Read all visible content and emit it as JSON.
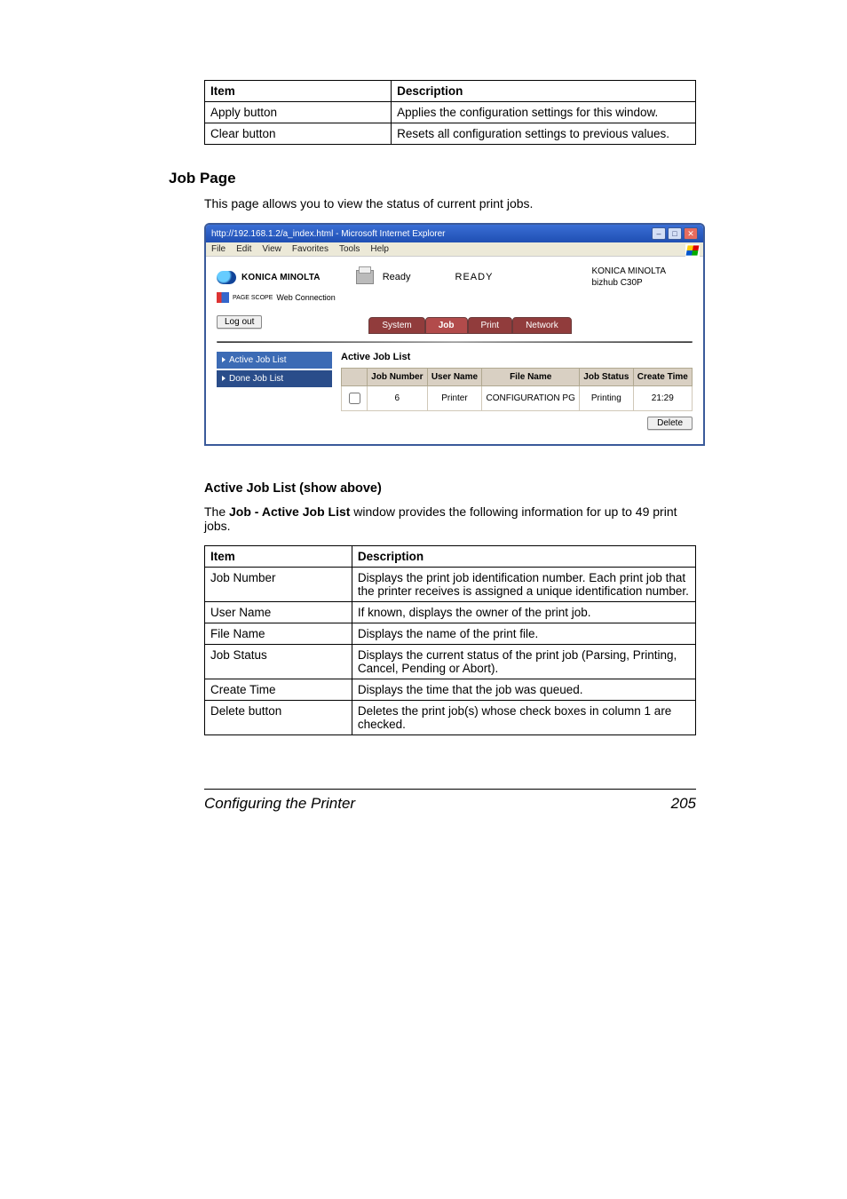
{
  "top_table": {
    "header_item": "Item",
    "header_desc": "Description",
    "rows": [
      {
        "item": "Apply button",
        "desc": "Applies the configuration settings for this window."
      },
      {
        "item": "Clear button",
        "desc": "Resets all configuration settings to previous values."
      }
    ]
  },
  "job_page": {
    "heading": "Job Page",
    "intro": "This page allows you to view the status of current print jobs."
  },
  "ie_window": {
    "title": "http://192.168.1.2/a_index.html - Microsoft Internet Explorer",
    "menuitems": [
      "File",
      "Edit",
      "View",
      "Favorites",
      "Tools",
      "Help"
    ],
    "brand": "KONICA MINOLTA",
    "ready_icon_label": "Ready",
    "ready_top": "READY",
    "right_brand": "KONICA MINOLTA",
    "right_model": "bizhub C30P",
    "pagescope_label": "Web Connection",
    "pagescope_prefix": "PAGE SCOPE",
    "logout": "Log out",
    "tabs": {
      "system": "System",
      "job": "Job",
      "print": "Print",
      "network": "Network"
    },
    "sidebar": {
      "active": "Active Job List",
      "done": "Done Job List"
    },
    "joblist_title": "Active Job List",
    "job_headers": {
      "cb": "",
      "jobno": "Job Number",
      "user": "User Name",
      "file": "File Name",
      "status": "Job Status",
      "time": "Create Time"
    },
    "job_row": {
      "jobno": "6",
      "user": "Printer",
      "file": "CONFIGURATION PG",
      "status": "Printing",
      "time": "21:29"
    },
    "delete": "Delete"
  },
  "active_section": {
    "heading": "Active Job List (show above)",
    "intro_prefix": "The ",
    "intro_bold": "Job - Active Job List",
    "intro_suffix": " window provides the following information for up to 49 print jobs."
  },
  "details_table": {
    "header_item": "Item",
    "header_desc": "Description",
    "rows": [
      {
        "item": "Job Number",
        "desc": "Displays the print job identification number. Each print job that the printer receives is assigned a unique identification number."
      },
      {
        "item": "User Name",
        "desc": "If known, displays the owner of the print job."
      },
      {
        "item": "File Name",
        "desc": "Displays the name of the print file."
      },
      {
        "item": "Job Status",
        "desc": "Displays the current status of the print job (Parsing, Printing, Cancel, Pending or Abort)."
      },
      {
        "item": "Create Time",
        "desc": "Displays the time that the job was queued."
      },
      {
        "item": "Delete button",
        "desc": "Deletes the print job(s) whose check boxes in column 1 are checked."
      }
    ]
  },
  "footer": {
    "left": "Configuring the Printer",
    "right": "205"
  }
}
